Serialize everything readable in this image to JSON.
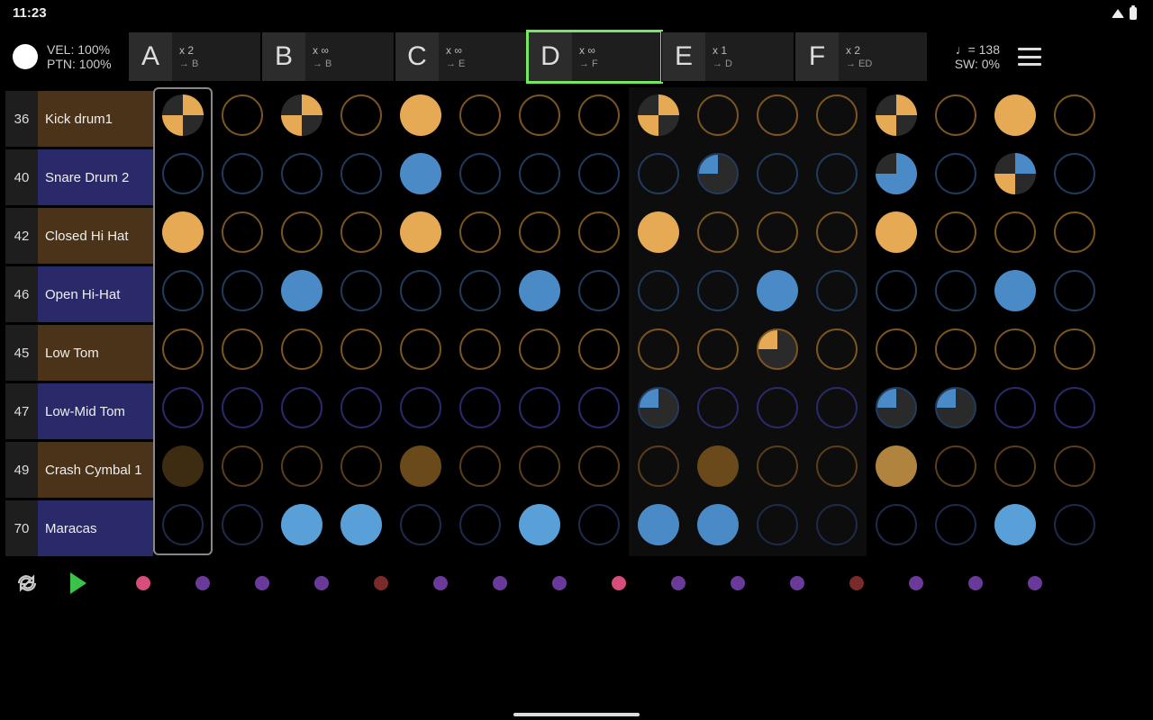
{
  "status": {
    "time": "11:23"
  },
  "header": {
    "vel": "VEL: 100%",
    "ptn": "PTN: 100%",
    "tempo": "♩= 138",
    "swing": "SW: 0%"
  },
  "patterns": [
    {
      "letter": "A",
      "times": "x 2",
      "next": "→ B",
      "active": false
    },
    {
      "letter": "B",
      "times": "x ∞",
      "next": "→ B",
      "active": false
    },
    {
      "letter": "C",
      "times": "x ∞",
      "next": "→ E",
      "active": false
    },
    {
      "letter": "D",
      "times": "x ∞",
      "next": "→ F",
      "active": true
    },
    {
      "letter": "E",
      "times": "x 1",
      "next": "→ D",
      "active": false
    },
    {
      "letter": "F",
      "times": "x 2",
      "next": "→ ED",
      "active": false
    }
  ],
  "tracks": [
    {
      "num": "36",
      "name": "Kick drum1",
      "color": "brown",
      "ring": "ring-orange",
      "cells": [
        "q75",
        "",
        "q75",
        "",
        "fill-orange",
        "",
        "",
        "",
        "q75",
        "",
        "",
        "",
        "q75",
        "",
        "fill-orange",
        ""
      ]
    },
    {
      "num": "40",
      "name": "Snare Drum 2",
      "color": "blue",
      "ring": "ring-blue",
      "cells": [
        "",
        "",
        "",
        "",
        "fill-blue",
        "",
        "",
        "",
        "",
        "q25tl",
        "",
        "",
        "q90bl",
        "",
        "q75b",
        ""
      ]
    },
    {
      "num": "42",
      "name": "Closed Hi Hat",
      "color": "brown",
      "ring": "ring-orange",
      "cells": [
        "fill-orange",
        "",
        "",
        "",
        "fill-orange",
        "",
        "",
        "",
        "fill-orange",
        "",
        "",
        "",
        "fill-orange",
        "",
        "",
        ""
      ]
    },
    {
      "num": "46",
      "name": "Open Hi-Hat",
      "color": "blue",
      "ring": "ring-blue",
      "cells": [
        "",
        "",
        "fill-blue",
        "",
        "",
        "",
        "fill-blue",
        "",
        "",
        "",
        "fill-blue",
        "",
        "",
        "",
        "fill-blue",
        ""
      ]
    },
    {
      "num": "45",
      "name": "Low Tom",
      "color": "brown",
      "ring": "ring-orange",
      "cells": [
        "",
        "",
        "",
        "",
        "",
        "",
        "",
        "",
        "",
        "",
        "q25tl-or",
        "",
        "",
        "",
        "",
        ""
      ]
    },
    {
      "num": "47",
      "name": "Low-Mid Tom",
      "color": "blue",
      "ring": "ring-purple",
      "cells": [
        "",
        "",
        "",
        "",
        "",
        "",
        "",
        "",
        "q25tl",
        "",
        "",
        "",
        "q25tl",
        "q25tl",
        "",
        ""
      ]
    },
    {
      "num": "49",
      "name": "Crash Cymbal 1",
      "color": "brown",
      "ring": "ring-brown",
      "cells": [
        "fill-dbrown",
        "",
        "",
        "",
        "fill-brown",
        "",
        "",
        "",
        "",
        "fill-brown",
        "",
        "",
        "fill-dorange",
        "",
        "",
        ""
      ]
    },
    {
      "num": "70",
      "name": "Maracas",
      "color": "blue",
      "ring": "ring-dblue",
      "cells": [
        "",
        "",
        "fill-lblue",
        "fill-lblue",
        "",
        "",
        "fill-lblue",
        "",
        "fill-blue",
        "fill-blue",
        "",
        "",
        "",
        "",
        "fill-lblue",
        ""
      ]
    }
  ],
  "dotbar": [
    "d-pink",
    "d-purple",
    "d-purple",
    "d-purple",
    "d-red",
    "d-purple",
    "d-purple",
    "d-purple",
    "d-pink",
    "d-purple",
    "d-purple",
    "d-purple",
    "d-red",
    "d-purple",
    "d-purple",
    "d-purple"
  ]
}
